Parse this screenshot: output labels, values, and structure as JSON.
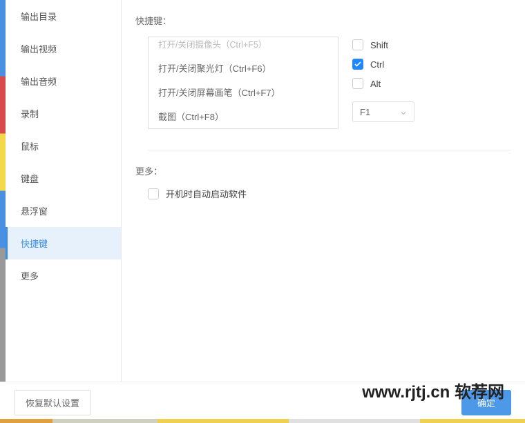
{
  "sidebar": {
    "items": [
      {
        "label": "输出目录"
      },
      {
        "label": "输出视频"
      },
      {
        "label": "输出音频"
      },
      {
        "label": "录制"
      },
      {
        "label": "鼠标"
      },
      {
        "label": "键盘"
      },
      {
        "label": "悬浮窗"
      },
      {
        "label": "快捷键"
      },
      {
        "label": "更多"
      }
    ],
    "active_index": 7
  },
  "shortcut_section": {
    "label": "快捷键：",
    "list": [
      {
        "label": "打开/关闭摄像头（Ctrl+F5）",
        "dim": true
      },
      {
        "label": "打开/关闭聚光灯（Ctrl+F6）"
      },
      {
        "label": "打开/关闭屏幕画笔（Ctrl+F7）"
      },
      {
        "label": "截图（Ctrl+F8）"
      }
    ],
    "modifiers": {
      "shift": {
        "label": "Shift",
        "checked": false
      },
      "ctrl": {
        "label": "Ctrl",
        "checked": true
      },
      "alt": {
        "label": "Alt",
        "checked": false
      }
    },
    "key_select": {
      "value": "F1"
    }
  },
  "more_section": {
    "label": "更多：",
    "autostart": {
      "label": "开机时自动启动软件",
      "checked": false
    }
  },
  "footer": {
    "restore_label": "恢复默认设置",
    "ok_label": "确定"
  },
  "watermark": "www.rjtj.cn 软荐网"
}
